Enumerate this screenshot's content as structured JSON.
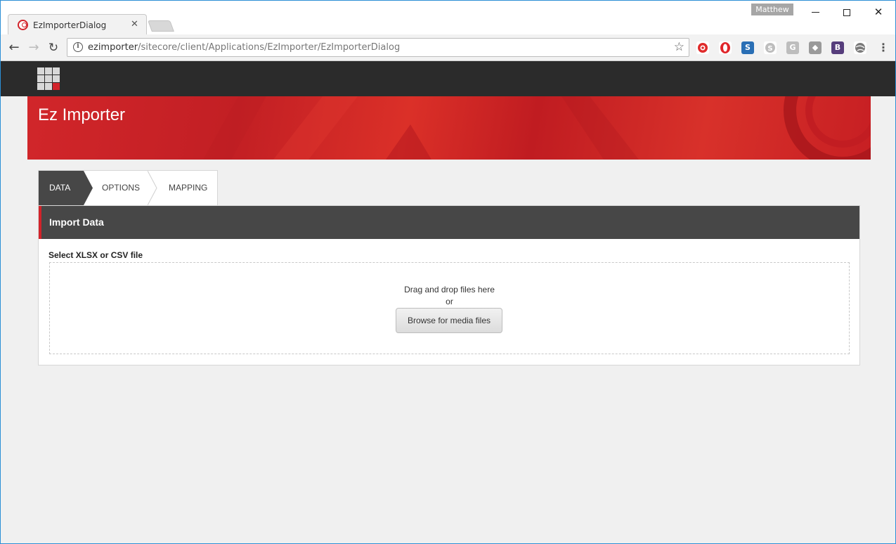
{
  "browser": {
    "tab_title": "EzImporterDialog",
    "profile_name": "Matthew",
    "url_host": "ezimporter",
    "url_path": "/sitecore/client/Applications/EzImporter/EzImporterDialog"
  },
  "app": {
    "banner_title": "Ez Importer",
    "accent_color": "#d2232a"
  },
  "steps": [
    {
      "label": "DATA",
      "active": true
    },
    {
      "label": "OPTIONS",
      "active": false
    },
    {
      "label": "MAPPING",
      "active": false
    }
  ],
  "panel": {
    "title": "Import Data",
    "field_label": "Select XLSX or CSV file",
    "dropzone_text": "Drag and drop files here",
    "or_text": "or",
    "browse_label": "Browse for media files"
  },
  "extensions": [
    {
      "icon": "red-circle-extension-icon",
      "color": "#e02b2b"
    },
    {
      "icon": "opera-extension-icon",
      "color": "#e0252a"
    },
    {
      "icon": "s-extension-icon",
      "color": "#2a6fb5"
    },
    {
      "icon": "skype-extension-icon",
      "color": "#b5b5b5"
    },
    {
      "icon": "g-extension-icon",
      "color": "#b5b5b5"
    },
    {
      "icon": "puzzle-extension-icon",
      "color": "#9a9a9a"
    },
    {
      "icon": "bootstrap-extension-icon",
      "color": "#563d7c"
    },
    {
      "icon": "globe-extension-icon",
      "color": "#7a7a7a"
    }
  ]
}
